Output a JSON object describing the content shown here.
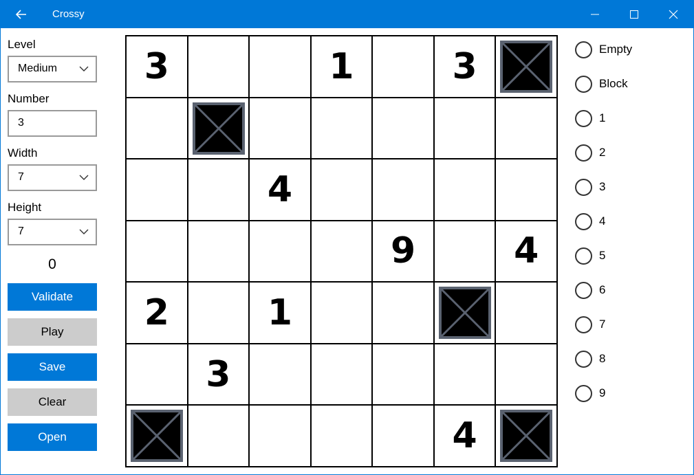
{
  "window": {
    "title": "Crossy"
  },
  "left": {
    "level_label": "Level",
    "level_value": "Medium",
    "number_label": "Number",
    "number_value": "3",
    "width_label": "Width",
    "width_value": "7",
    "height_label": "Height",
    "height_value": "7",
    "score": "0",
    "buttons": {
      "validate": "Validate",
      "play": "Play",
      "save": "Save",
      "clear": "Clear",
      "open": "Open"
    }
  },
  "board": {
    "rows": 7,
    "cols": 7,
    "cells": [
      [
        "3",
        "",
        "",
        "1",
        "",
        "3",
        "X"
      ],
      [
        "",
        "X",
        "",
        "",
        "",
        "",
        ""
      ],
      [
        "",
        "",
        "4",
        "",
        "",
        "",
        ""
      ],
      [
        "",
        "",
        "",
        "",
        "9",
        "",
        "4"
      ],
      [
        "2",
        "",
        "1",
        "",
        "",
        "X",
        ""
      ],
      [
        "",
        "3",
        "",
        "",
        "",
        "",
        ""
      ],
      [
        "X",
        "",
        "",
        "",
        "",
        "4",
        "X"
      ]
    ]
  },
  "options": [
    "Empty",
    "Block",
    "1",
    "2",
    "3",
    "4",
    "5",
    "6",
    "7",
    "8",
    "9"
  ],
  "colors": {
    "accent": "#0078d7",
    "button_gray": "#cccccc",
    "block_border": "#5a6270"
  }
}
